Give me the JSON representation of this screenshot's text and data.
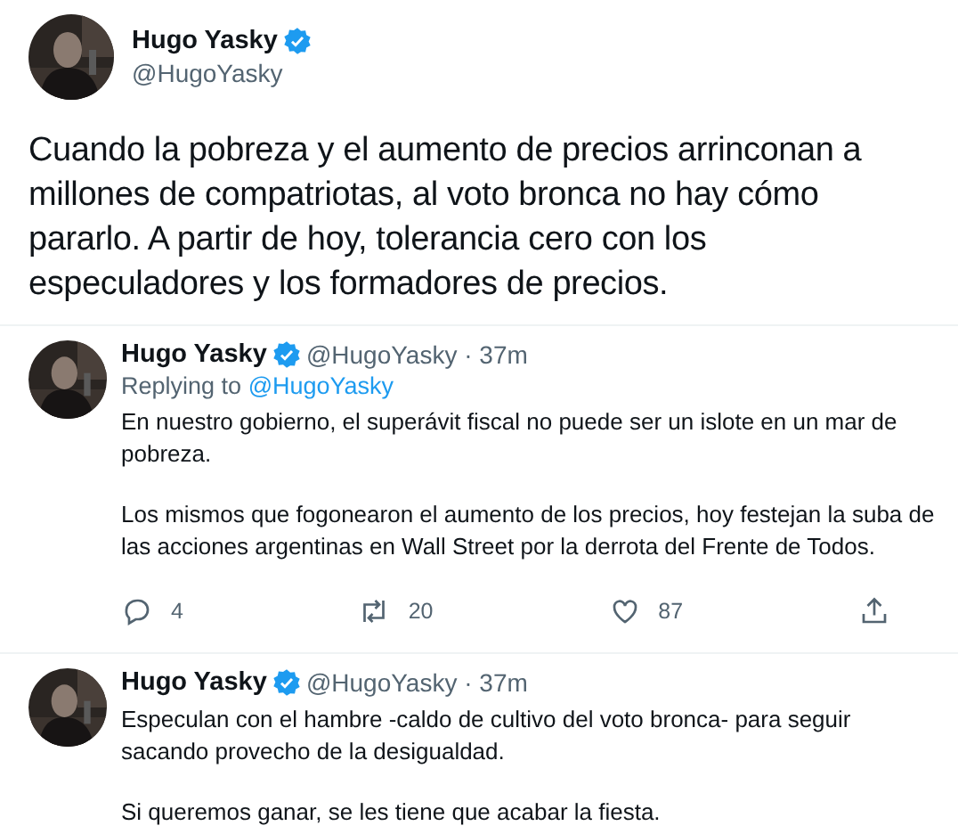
{
  "main_tweet": {
    "author": "Hugo Yasky",
    "verified": true,
    "handle": "@HugoYasky",
    "text": "Cuando la pobreza y el aumento de precios arrinconan a millones de compatriotas, al voto bronca no hay cómo pararlo. A partir de hoy, tolerancia cero con los especuladores y los formadores de precios."
  },
  "replies": [
    {
      "author": "Hugo Yasky",
      "verified": true,
      "meta": "@HugoYasky · 37m",
      "replying_label": "Replying to",
      "replying_to": "@HugoYasky",
      "paragraphs": [
        "En nuestro gobierno, el superávit fiscal no puede ser un islote en un mar de pobreza.",
        "Los mismos que fogonearon el aumento de los precios, hoy festejan la suba de las acciones argentinas en Wall Street por la derrota del Frente de Todos."
      ],
      "actions": {
        "replies": "4",
        "retweets": "20",
        "likes": "87"
      }
    },
    {
      "author": "Hugo Yasky",
      "verified": true,
      "meta": "@HugoYasky · 37m",
      "paragraphs": [
        "Especulan con el hambre -caldo de cultivo del voto bronca- para seguir sacando provecho de la desigualdad.",
        "Si queremos ganar, se les tiene que acabar la fiesta."
      ]
    }
  ]
}
